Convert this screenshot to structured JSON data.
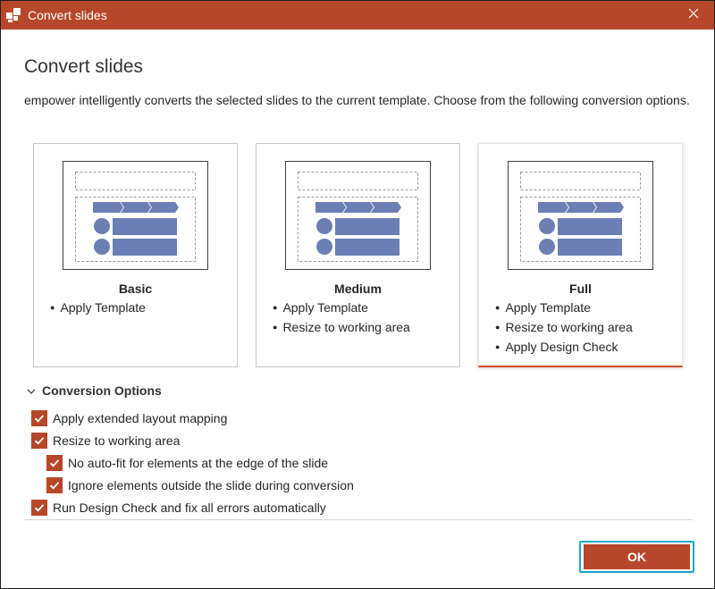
{
  "window": {
    "title": "Convert slides",
    "accent_color": "#b7472a",
    "icons": {
      "app": "app-logo-icon",
      "close": "close-icon"
    }
  },
  "dialog": {
    "heading": "Convert slides",
    "description": "empower intelligently converts the selected slides to the current template. Choose from the following conversion options."
  },
  "cards": [
    {
      "title": "Basic",
      "bullets": [
        "Apply Template"
      ],
      "selected": false
    },
    {
      "title": "Medium",
      "bullets": [
        "Apply Template",
        "Resize to working area"
      ],
      "selected": false
    },
    {
      "title": "Full",
      "bullets": [
        "Apply Template",
        "Resize to working area",
        "Apply Design Check"
      ],
      "selected": true
    }
  ],
  "conversion_options": {
    "label": "Conversion Options",
    "expanded": true,
    "items": [
      {
        "label": "Apply extended layout mapping",
        "checked": true
      },
      {
        "label": "Resize to working area",
        "checked": true
      },
      {
        "label": "No auto-fit for elements at the edge of the slide",
        "checked": true
      },
      {
        "label": "Ignore elements outside the slide during conversion",
        "checked": true
      },
      {
        "label": "Run Design Check and fix all errors automatically",
        "checked": true
      }
    ]
  },
  "footer": {
    "ok_label": "OK",
    "focus_color": "#1aa7c9"
  }
}
